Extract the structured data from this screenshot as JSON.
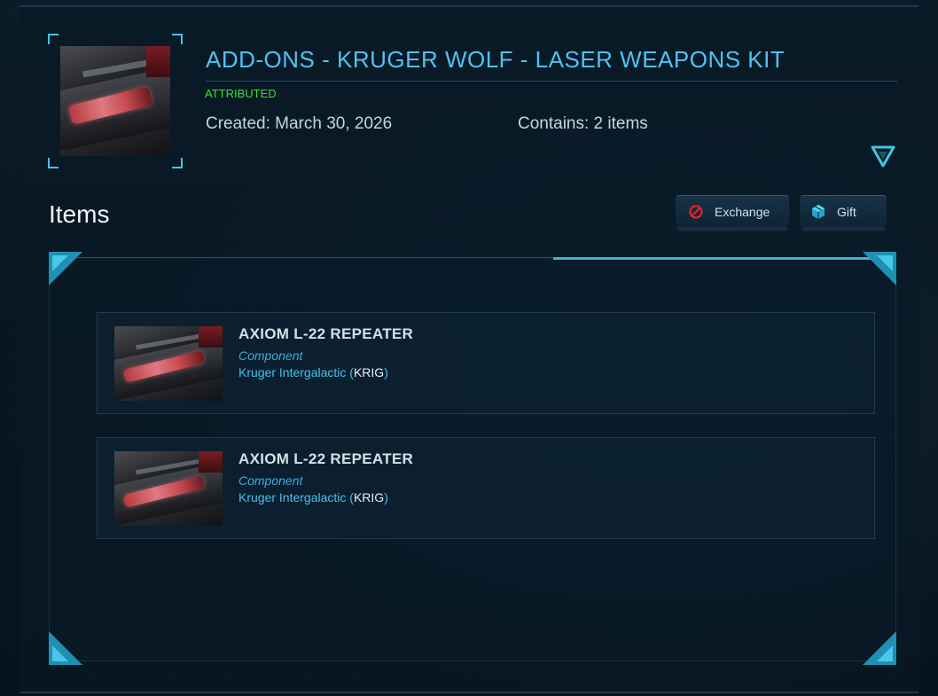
{
  "pledge": {
    "title": "ADD-ONS - KRUGER WOLF - LASER WEAPONS KIT",
    "status": "ATTRIBUTED",
    "created": "Created: March 30, 2026",
    "contains": "Contains: 2 items",
    "expand_icon": "triangle-down-icon"
  },
  "items_section": {
    "heading": "Items",
    "exchange_label": "Exchange",
    "exchange_icon": "prohibited-icon",
    "gift_label": "Gift",
    "gift_icon": "gift-box-icon"
  },
  "items": [
    {
      "name": "AXIOM L-22 REPEATER",
      "type": "Component",
      "manufacturer": "Kruger Intergalactic",
      "manufacturer_code": "KRIG"
    },
    {
      "name": "AXIOM L-22 REPEATER",
      "type": "Component",
      "manufacturer": "Kruger Intergalactic",
      "manufacturer_code": "KRIG"
    }
  ],
  "colors": {
    "accent": "#3ec6e6",
    "title": "#4fc3f0",
    "status_attributed": "#35e42c",
    "exchange_icon": "#e0262b"
  }
}
